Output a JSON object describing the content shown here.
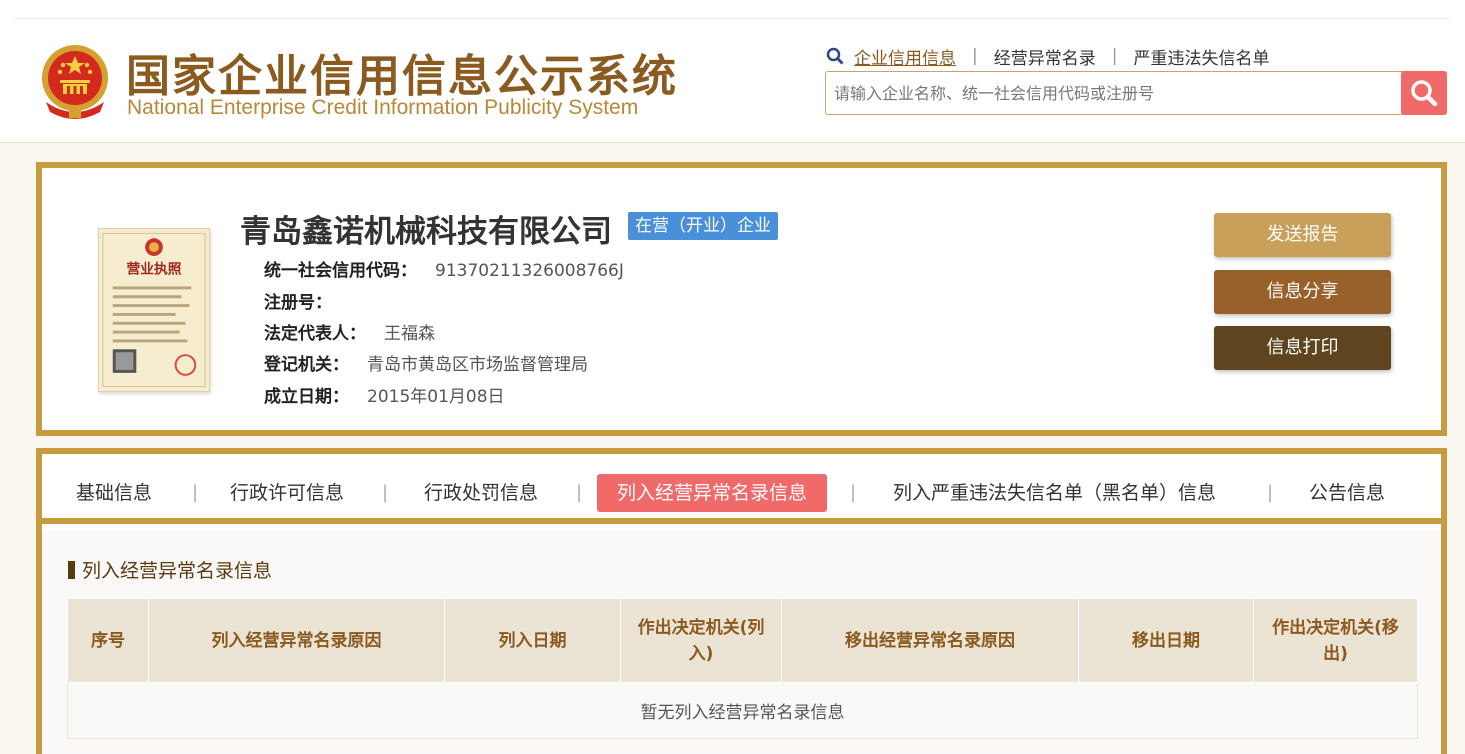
{
  "header": {
    "title_cn": "国家企业信用信息公示系统",
    "title_en": "National Enterprise Credit Information Publicity System",
    "links": [
      "企业信用信息",
      "经营异常名录",
      "严重违法失信名单"
    ],
    "active_link_index": 0,
    "search_placeholder": "请输入企业名称、统一社会信用代码或注册号",
    "brand_color": "#8b5a1e",
    "accent_color": "#f06a6a"
  },
  "company": {
    "name": "青岛鑫诺机械科技有限公司",
    "status": "在营（开业）企业",
    "license_title": "营业执照",
    "fields": [
      {
        "label": "统一社会信用代码：",
        "value": "91370211326008766J"
      },
      {
        "label": "注册号：",
        "value": ""
      },
      {
        "label": "法定代表人：",
        "value": "王福森"
      },
      {
        "label": "登记机关：",
        "value": "青岛市黄岛区市场监督管理局"
      },
      {
        "label": "成立日期：",
        "value": "2015年01月08日"
      }
    ],
    "buttons": {
      "send_report": "发送报告",
      "share": "信息分享",
      "print": "信息打印"
    }
  },
  "tabs": [
    {
      "label": "基础信息"
    },
    {
      "label": "行政许可信息"
    },
    {
      "label": "行政处罚信息"
    },
    {
      "label": "列入经营异常名录信息"
    },
    {
      "label": "列入严重违法失信名单（黑名单）信息"
    },
    {
      "label": "公告信息"
    }
  ],
  "active_tab_index": 3,
  "section": {
    "title": "列入经营异常名录信息",
    "columns": [
      "序号",
      "列入经营异常名录原因",
      "列入日期",
      "作出决定机关(列入)",
      "移出经营异常名录原因",
      "移出日期",
      "作出决定机关(移出)"
    ],
    "empty_text": "暂无列入经营异常名录信息"
  }
}
